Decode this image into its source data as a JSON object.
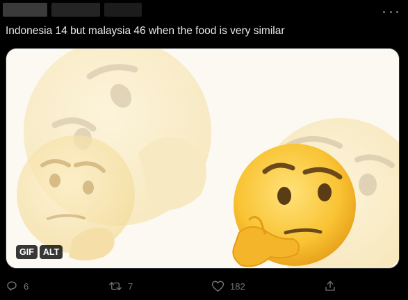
{
  "tweet": {
    "text": "Indonesia 14 but malaysia 46 when the food is very similar"
  },
  "media": {
    "gif_label": "GIF",
    "alt_label": "ALT",
    "icon": "thinking-face-icon"
  },
  "actions": {
    "reply_count": "6",
    "retweet_count": "7",
    "like_count": "182"
  },
  "colors": {
    "background": "#000000",
    "text": "#e7e9ea",
    "muted": "#71767b",
    "emoji": "#f9c333"
  }
}
